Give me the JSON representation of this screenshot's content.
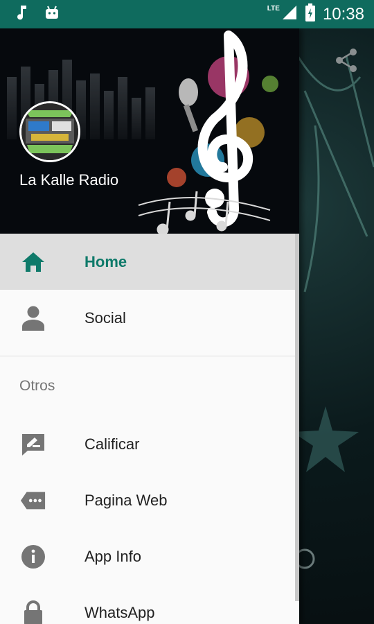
{
  "status_bar": {
    "time": "10:38",
    "network": "LTE",
    "icons": [
      "music-note-icon",
      "android-icon",
      "signal-icon",
      "battery-icon"
    ]
  },
  "drawer": {
    "station_name": "La Kalle Radio",
    "items": [
      {
        "label": "Home",
        "icon": "home-icon",
        "active": true
      },
      {
        "label": "Social",
        "icon": "person-icon",
        "active": false
      }
    ],
    "section_label": "Otros",
    "other_items": [
      {
        "label": "Calificar",
        "icon": "rate-review-icon"
      },
      {
        "label": "Pagina Web",
        "icon": "web-tag-icon"
      },
      {
        "label": "App Info",
        "icon": "info-icon"
      },
      {
        "label": "WhatsApp",
        "icon": "lock-icon"
      }
    ]
  },
  "colors": {
    "accent": "#0f7a6a",
    "status_bar": "#0f6b5e",
    "icon_grey": "#757575"
  }
}
